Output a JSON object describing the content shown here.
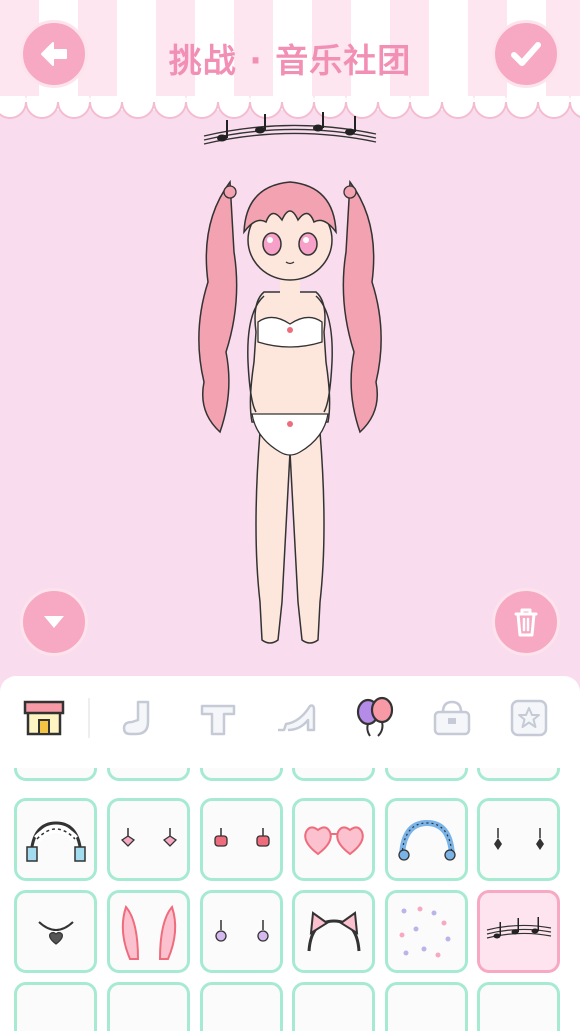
{
  "header": {
    "title": "挑战 · 音乐社团"
  },
  "icons": {
    "back": "back-arrow-icon",
    "confirm": "checkmark-icon",
    "collapse": "chevron-down-icon",
    "delete": "trash-icon"
  },
  "colors": {
    "background": "#f9dced",
    "accent_pink": "#f7a9c4",
    "title_pink": "#f28fb4",
    "cell_border": "#a7ead2",
    "selected_border": "#f7a9c4"
  },
  "tabs": [
    {
      "name": "shop",
      "icon": "shop-icon",
      "active": true
    },
    {
      "name": "socks",
      "icon": "sock-icon",
      "active": false
    },
    {
      "name": "tops",
      "icon": "shirt-icon",
      "active": false
    },
    {
      "name": "shoes",
      "icon": "high-heel-icon",
      "active": false
    },
    {
      "name": "accessories",
      "icon": "balloons-icon",
      "active": true
    },
    {
      "name": "bags",
      "icon": "bag-icon",
      "active": false
    },
    {
      "name": "favorites",
      "icon": "star-icon",
      "active": false
    }
  ],
  "items": [
    {
      "name": "maid-headband",
      "selected": false
    },
    {
      "name": "pink-bow-earrings",
      "selected": false
    },
    {
      "name": "red-bow-earrings",
      "selected": false
    },
    {
      "name": "heart-sunglasses",
      "selected": false
    },
    {
      "name": "blue-lace-headband",
      "selected": false
    },
    {
      "name": "black-drop-earrings",
      "selected": false
    },
    {
      "name": "heart-necklace",
      "selected": false
    },
    {
      "name": "bunny-ears",
      "selected": false
    },
    {
      "name": "purple-earrings",
      "selected": false
    },
    {
      "name": "cat-ear-headband",
      "selected": false
    },
    {
      "name": "confetti-sparkles",
      "selected": false
    },
    {
      "name": "music-notes-accessory",
      "selected": true
    }
  ]
}
